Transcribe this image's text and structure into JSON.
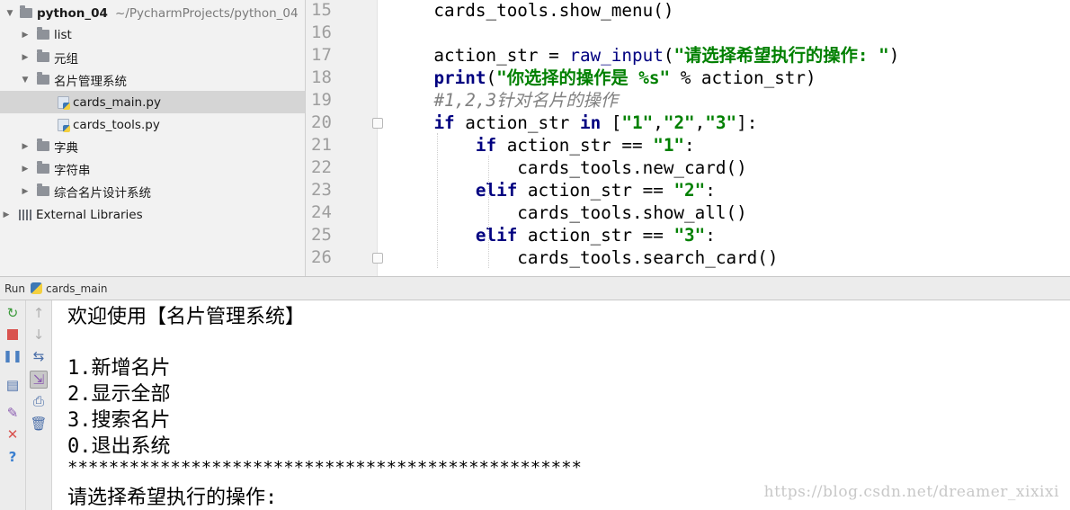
{
  "project_tree": {
    "root": {
      "name": "python_04",
      "path": "~/PycharmProjects/python_04"
    },
    "items": [
      {
        "label": "list"
      },
      {
        "label": "元组"
      },
      {
        "label": "名片管理系统"
      },
      {
        "label": "cards_main.py"
      },
      {
        "label": "cards_tools.py"
      },
      {
        "label": "字典"
      },
      {
        "label": "字符串"
      },
      {
        "label": "综合名片设计系统"
      },
      {
        "label": "External Libraries"
      }
    ]
  },
  "editor": {
    "line_numbers": [
      "15",
      "16",
      "17",
      "18",
      "19",
      "20",
      "21",
      "22",
      "23",
      "24",
      "25",
      "26"
    ],
    "lines": [
      [
        {
          "t": "    cards_tools.show_menu()"
        }
      ],
      [],
      [
        {
          "t": "    action_str = "
        },
        {
          "t": "raw_input",
          "c": "bi"
        },
        {
          "t": "("
        },
        {
          "t": "\"请选择希望执行的操作: \"",
          "c": "str"
        },
        {
          "t": ")"
        }
      ],
      [
        {
          "t": "    "
        },
        {
          "t": "print",
          "c": "kw"
        },
        {
          "t": "("
        },
        {
          "t": "\"你选择的操作是 %s\"",
          "c": "str"
        },
        {
          "t": " % action_str)"
        }
      ],
      [
        {
          "t": "    "
        },
        {
          "t": "#1,2,3针对名片的操作",
          "c": "comment"
        }
      ],
      [
        {
          "t": "    "
        },
        {
          "t": "if",
          "c": "kw"
        },
        {
          "t": " action_str "
        },
        {
          "t": "in",
          "c": "kw"
        },
        {
          "t": " ["
        },
        {
          "t": "\"1\"",
          "c": "str"
        },
        {
          "t": ","
        },
        {
          "t": "\"2\"",
          "c": "str"
        },
        {
          "t": ","
        },
        {
          "t": "\"3\"",
          "c": "str"
        },
        {
          "t": "]:"
        }
      ],
      [
        {
          "t": "        "
        },
        {
          "t": "if",
          "c": "kw"
        },
        {
          "t": " action_str == "
        },
        {
          "t": "\"1\"",
          "c": "str"
        },
        {
          "t": ":"
        }
      ],
      [
        {
          "t": "            cards_tools.new_card()"
        }
      ],
      [
        {
          "t": "        "
        },
        {
          "t": "elif",
          "c": "kw"
        },
        {
          "t": " action_str == "
        },
        {
          "t": "\"2\"",
          "c": "str"
        },
        {
          "t": ":"
        }
      ],
      [
        {
          "t": "            cards_tools.show_all()"
        }
      ],
      [
        {
          "t": "        "
        },
        {
          "t": "elif",
          "c": "kw"
        },
        {
          "t": " action_str == "
        },
        {
          "t": "\"3\"",
          "c": "str"
        },
        {
          "t": ":"
        }
      ],
      [
        {
          "t": "            cards_tools.search_card()"
        }
      ]
    ]
  },
  "run": {
    "label": "Run",
    "config": "cards_main",
    "left_toolbar": [
      "rerun-icon",
      "stop-icon",
      "pause-icon",
      "layout-icon",
      "pin-icon",
      "close-icon",
      "help-icon"
    ],
    "right_toolbar": [
      "up-arrow-icon",
      "down-arrow-icon",
      "soft-wrap-icon",
      "scroll-to-end-icon",
      "print-icon",
      "trash-icon"
    ]
  },
  "console": {
    "lines": [
      "欢迎使用【名片管理系统】",
      "",
      "1.新增名片",
      "2.显示全部",
      "3.搜索名片",
      "0.退出系统",
      "**************************************************",
      "请选择希望执行的操作:"
    ]
  },
  "watermark": "https://blog.csdn.net/dreamer_xixixi",
  "colors": {
    "keyword": "#000080",
    "string": "#008000",
    "comment": "#808080",
    "panel_bg": "#f2f2f2",
    "selection": "#d5d5d5"
  }
}
